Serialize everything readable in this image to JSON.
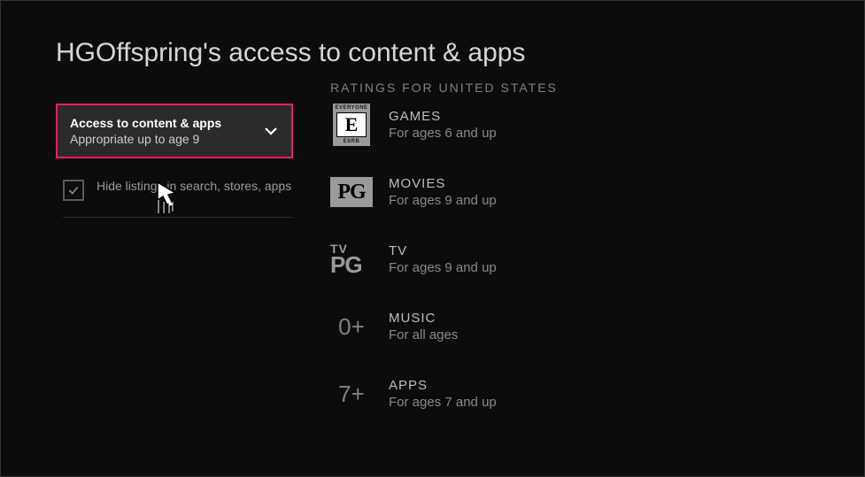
{
  "title": "HGOffspring's access to content & apps",
  "ratings_header": "RATINGS FOR UNITED STATES",
  "dropdown": {
    "label": "Access to content & apps",
    "value": "Appropriate up to age 9"
  },
  "checkbox": {
    "checked": true,
    "label": "Hide listings in search, stores, apps"
  },
  "ratings": [
    {
      "icon": "esrb-e",
      "badge_top": "EVERYONE",
      "badge_mid": "E",
      "badge_bot": "ESRB",
      "category": "GAMES",
      "detail": "For ages 6 and up"
    },
    {
      "icon": "pg",
      "badge_text": "PG",
      "category": "MOVIES",
      "detail": "For ages 9 and up"
    },
    {
      "icon": "tvpg",
      "badge_tv": "TV",
      "badge_pg": "PG",
      "category": "TV",
      "detail": "For ages 9 and up"
    },
    {
      "icon": "age",
      "badge_text": "0+",
      "category": "MUSIC",
      "detail": "For all ages"
    },
    {
      "icon": "age",
      "badge_text": "7+",
      "category": "APPS",
      "detail": "For ages 7 and up"
    }
  ]
}
